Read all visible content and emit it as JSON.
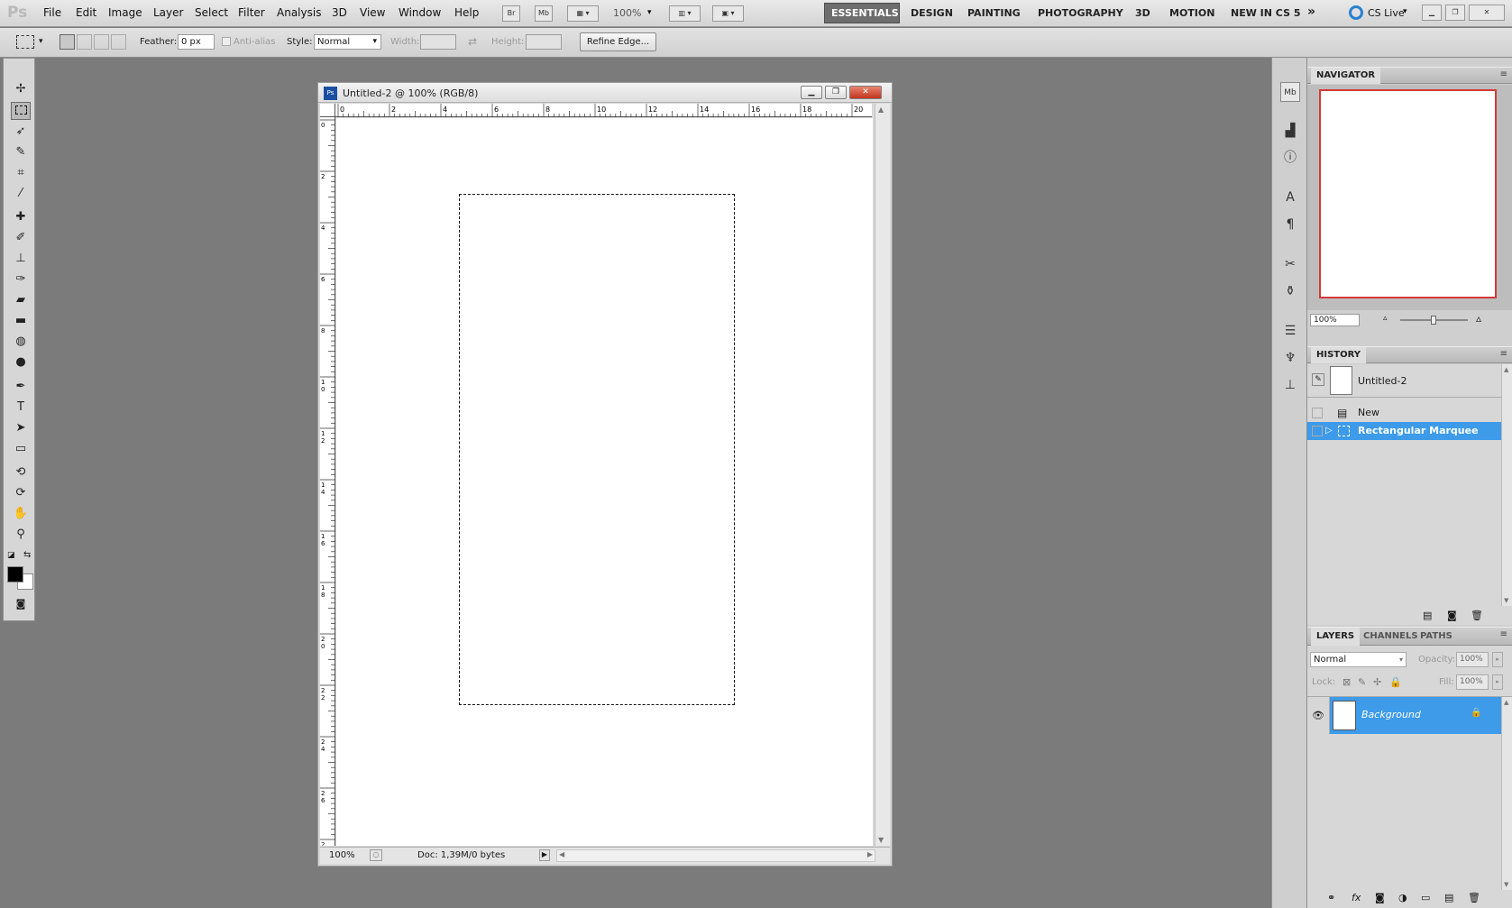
{
  "app": {
    "logo": "Ps"
  },
  "menubar": {
    "items": [
      "File",
      "Edit",
      "Image",
      "Layer",
      "Select",
      "Filter",
      "Analysis",
      "3D",
      "View",
      "Window",
      "Help"
    ],
    "bridge": "Br",
    "minibridge": "Mb",
    "zoom": "100%",
    "workspaces": [
      "ESSENTIALS",
      "DESIGN",
      "PAINTING",
      "PHOTOGRAPHY",
      "3D",
      "MOTION",
      "NEW IN CS 5"
    ],
    "more": "»",
    "cslive": "CS Live",
    "win_min": "▁",
    "win_max": "❐",
    "win_close": "✕"
  },
  "options": {
    "feather_label": "Feather:",
    "feather_value": "0 px",
    "antialias_label": "Anti-alias",
    "style_label": "Style:",
    "style_value": "Normal",
    "width_label": "Width:",
    "height_label": "Height:",
    "swap_icon": "⇄",
    "refine_label": "Refine Edge..."
  },
  "document": {
    "title": "Untitled-2 @ 100% (RGB/8)",
    "ps_icon": "Ps",
    "zoom": "100%",
    "doc_info": "Doc: 1,39M/0 bytes",
    "ruler_top": [
      "0",
      "2",
      "4",
      "6",
      "8",
      "10",
      "12",
      "14",
      "16",
      "18",
      "20"
    ],
    "ruler_left": [
      "0",
      "2",
      "4",
      "6",
      "8",
      "10",
      "12",
      "14",
      "16",
      "18",
      "20",
      "22",
      "24",
      "26",
      "28"
    ]
  },
  "panels": {
    "navigator_tab": "NAVIGATOR",
    "navigator_zoom": "100%",
    "history_tab": "HISTORY",
    "history_snapshot": "Untitled-2",
    "history_items": [
      "New",
      "Rectangular Marquee"
    ],
    "layers_tabs": [
      "LAYERS",
      "CHANNELS",
      "PATHS"
    ],
    "blend_mode": "Normal",
    "opacity_label": "Opacity:",
    "opacity_value": "100%",
    "lock_label": "Lock:",
    "fill_label": "Fill:",
    "fill_value": "100%",
    "layer_name": "Background"
  }
}
